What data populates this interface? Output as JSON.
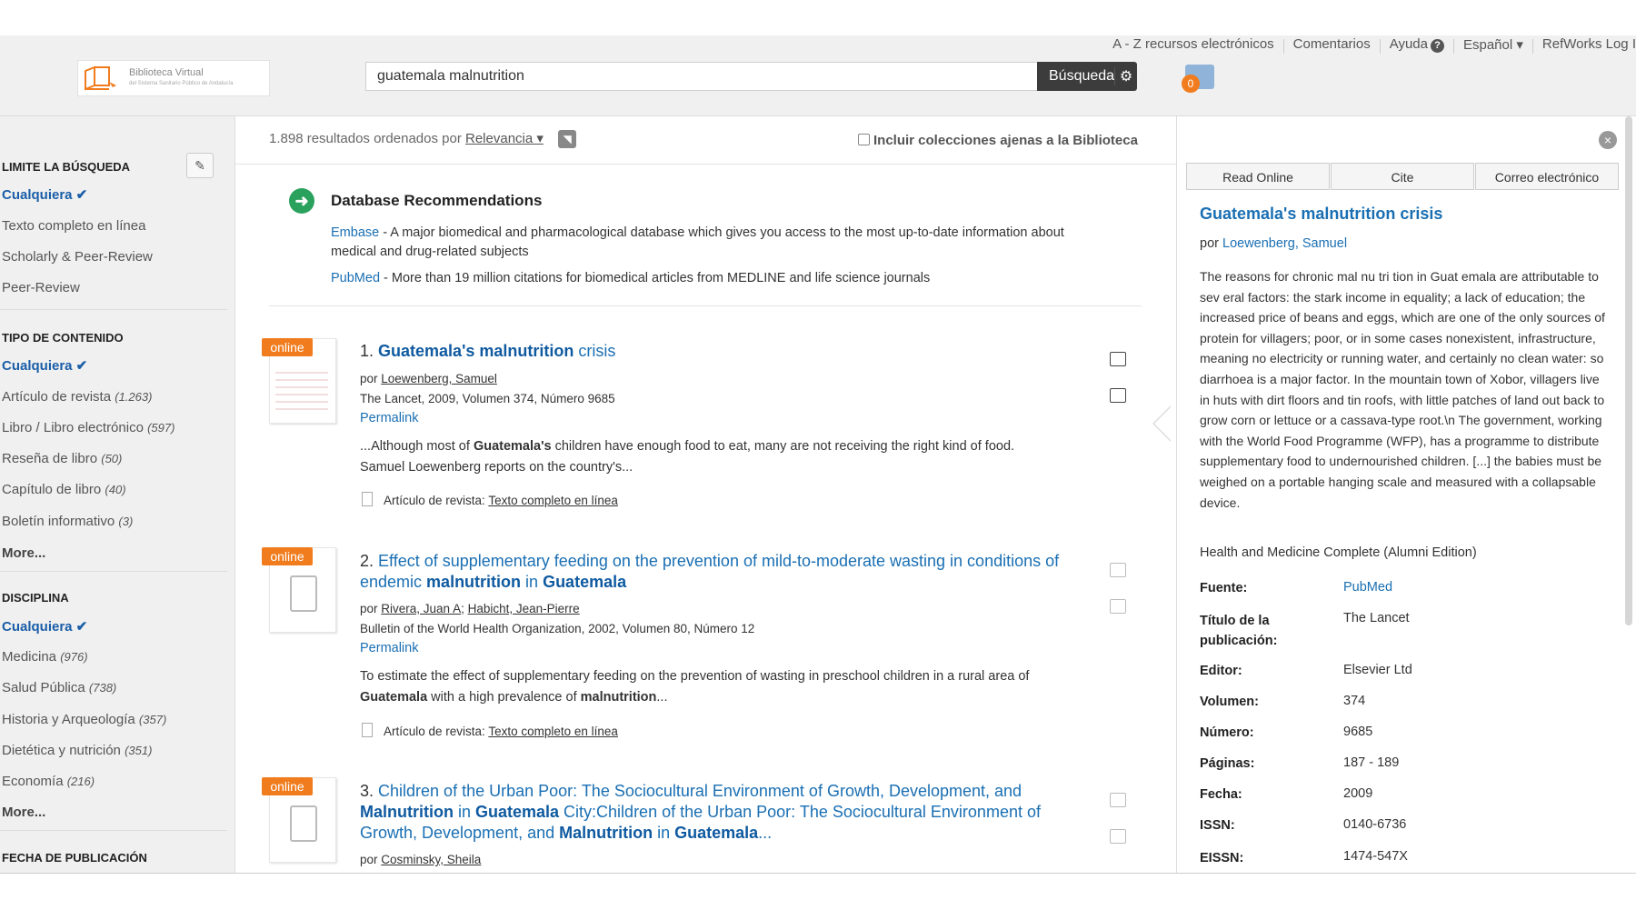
{
  "toplinks": {
    "az": "A - Z recursos electrónicos",
    "comments": "Comentarios",
    "help": "Ayuda",
    "help_badge": "?",
    "language": "Español ▾",
    "refworks": "RefWorks Log I"
  },
  "logo": {
    "line1": "Biblioteca Virtual",
    "line2": "del Sistema Sanitario Público de Andalucía"
  },
  "search": {
    "value": "guatemala malnutrition",
    "button": "Búsqueda",
    "gear": "⚙"
  },
  "folder": {
    "count": "0"
  },
  "sidebar": {
    "limit_title": "Limite la búsqueda",
    "limit_any": "Cualquiera ✔",
    "limit_items": [
      "Texto completo en línea",
      "Scholarly & Peer-Review",
      "Peer-Review"
    ],
    "content_title": "Tipo de contenido",
    "content_any": "Cualquiera ✔",
    "content_items": [
      {
        "label": "Artículo de revista",
        "count": "(1.263)"
      },
      {
        "label": "Libro / Libro electrónico",
        "count": "(597)"
      },
      {
        "label": "Reseña de libro",
        "count": "(50)"
      },
      {
        "label": "Capítulo de libro",
        "count": "(40)"
      },
      {
        "label": "Boletín informativo",
        "count": "(3)"
      }
    ],
    "content_more": "More...",
    "disc_title": "Disciplina",
    "disc_any": "Cualquiera ✔",
    "disc_items": [
      {
        "label": "Medicina",
        "count": "(976)"
      },
      {
        "label": "Salud Pública",
        "count": "(738)"
      },
      {
        "label": "Historia y Arqueología",
        "count": "(357)"
      },
      {
        "label": "Dietética y nutrición",
        "count": "(351)"
      },
      {
        "label": "Economía",
        "count": "(216)"
      }
    ],
    "disc_more": "More...",
    "date_title": "Fecha de publicación"
  },
  "results_bar": {
    "count_text": "1.898 resultados ordenados por",
    "sort": "Relevancia ▾",
    "include": "Incluir colecciones ajenas a la Biblioteca"
  },
  "recommendations": {
    "title": "Database Recommendations",
    "embase_link": "Embase",
    "embase_text": " - A major biomedical and pharmacological database which gives you access to the most up-to-date information about",
    "embase_text2": "medical and drug-related subjects",
    "pubmed_link": "PubMed",
    "pubmed_text": " - More than 19 million citations for biomedical articles from MEDLINE and life science journals"
  },
  "results": [
    {
      "badge": "online",
      "num": "1.",
      "title_a": "Guatemala's malnutrition",
      "title_b": " crisis",
      "by_prefix": "por",
      "author": "Loewenberg, Samuel",
      "source": "The Lancet, 2009, Volumen 374, Número 9685",
      "permalink": "Permalink",
      "abstract_1": "...Although most of ",
      "abstract_b1": "Guatemala's",
      "abstract_2": " children have enough food to eat, many are not receiving the right kind of food.",
      "abstract_3": "Samuel Loewenberg reports on the country's...",
      "type_prefix": "Artículo de revista:",
      "type_link": "Texto completo en línea"
    },
    {
      "badge": "online",
      "num": "2.",
      "title_1": " Effect of supplementary feeding on the prevention of mild-to-moderate wasting in conditions of",
      "title_2": "endemic ",
      "title_b1": "malnutrition",
      "title_3": " in ",
      "title_b2": "Guatemala",
      "by_prefix": "por",
      "author": "Rivera, Juan A",
      "author2": "Habicht, Jean-Pierre",
      "source": "Bulletin of the World Health Organization, 2002, Volumen 80, Número 12",
      "permalink": "Permalink",
      "abstract_1": "To estimate the effect of supplementary feeding on the prevention of wasting in preschool children in a rural area of",
      "abstract_b1": "Guatemala",
      "abstract_2": " with a high prevalence of ",
      "abstract_b2": "malnutrition",
      "abstract_3": "...",
      "type_prefix": "Artículo de revista:",
      "type_link": "Texto completo en línea"
    },
    {
      "badge": "online",
      "num": "3.",
      "title_1": " Children of the Urban Poor: The Sociocultural Environment of Growth, Development, and",
      "title_b1": "Malnutrition",
      "title_2": " in ",
      "title_b2": "Guatemala",
      "title_3": " City:Children of the Urban Poor: The Sociocultural Environment of",
      "title_4": "Growth, Development, and ",
      "title_b3": "Malnutrition",
      "title_5": " in ",
      "title_b4": "Guatemala",
      "title_6": "...",
      "by_prefix": "por",
      "author": "Cosminsky, Sheila"
    }
  ],
  "panel": {
    "tabs": [
      "Read Online",
      "Cite",
      "Correo electrónico"
    ],
    "close": "×",
    "title": "Guatemala's malnutrition crisis",
    "by_prefix": "por",
    "author": "Loewenberg, Samuel",
    "abstract": "The reasons for chronic mal nu tri tion in Guat emala are attributable to sev eral factors: the stark income in equality; a lack of education; the increased price of beans and eggs, which are one of the only sources of protein for villagers; poor, or in some cases nonexistent, infrastructure, meaning no electricity or running water, and certainly no clean water: so diarrhoea is a major factor. In the mountain town of Xobor, villagers live in huts with dirt floors and tin roofs, with little patches of land out back to grow corn or lettuce or a cassava-type root.\\n The government, working with the World Food Programme (WFP), has a programme to distribute supplementary food to undernourished children. [...] the babies must be weighed on a portable hanging scale and measured with a collapsable device.",
    "database": "Health and Medicine Complete (Alumni Edition)",
    "fields": [
      {
        "k": "Fuente:",
        "v": "PubMed"
      },
      {
        "k": "Título de la publicación:",
        "v": "The Lancet"
      },
      {
        "k": "Editor:",
        "v": "Elsevier Ltd"
      },
      {
        "k": "Volumen:",
        "v": "374"
      },
      {
        "k": "Número:",
        "v": "9685"
      },
      {
        "k": "Páginas:",
        "v": "187 - 189"
      },
      {
        "k": "Fecha:",
        "v": "2009"
      },
      {
        "k": "ISSN:",
        "v": "0140-6736"
      },
      {
        "k": "EISSN:",
        "v": "1474-547X"
      }
    ]
  }
}
